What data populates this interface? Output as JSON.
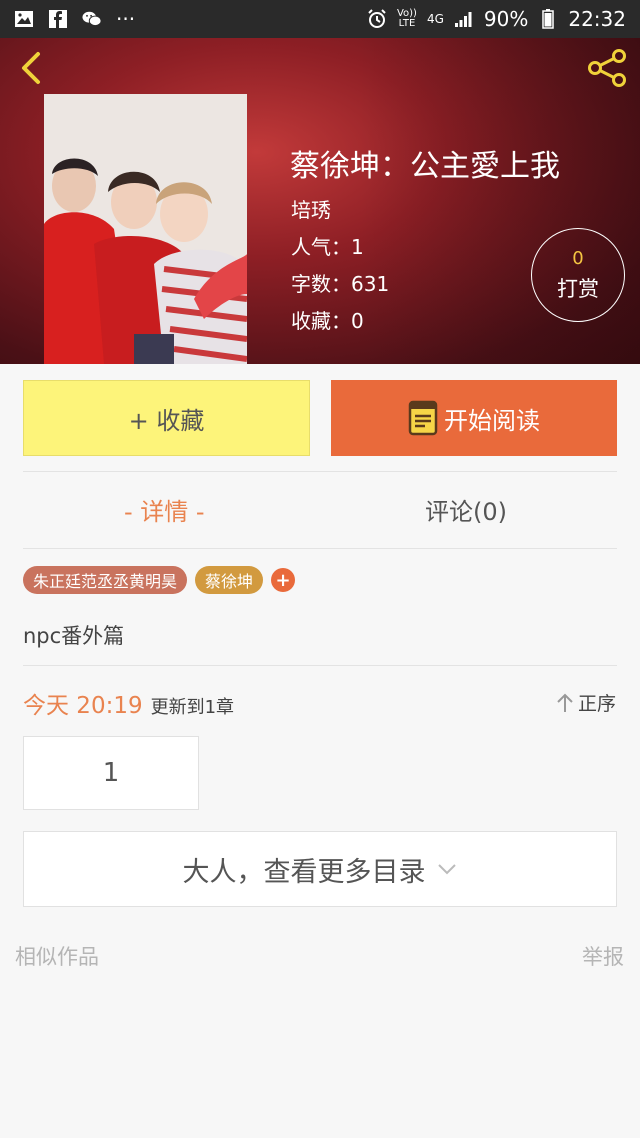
{
  "statusbar": {
    "network_lte_top": "Vo))",
    "network_lte_bottom": "LTE",
    "network_4g": "4G",
    "battery": "90%",
    "time": "22:32",
    "more_dots": "···"
  },
  "book": {
    "title": "蔡徐坤：公主愛上我",
    "author": "培琇",
    "popularity": "人气：1",
    "word_count": "字数：631",
    "favorites": "收藏：0"
  },
  "reward": {
    "count": "0",
    "label": "打赏"
  },
  "actions": {
    "favorite_label": "+ 收藏",
    "read_label": "开始阅读"
  },
  "tabs": {
    "detail": "- 详情 -",
    "comments": "评论(0)"
  },
  "tags": [
    "朱正廷范丞丞黄明昊",
    "蔡徐坤"
  ],
  "tag_add": "+",
  "description": "npc番外篇",
  "update": {
    "time": "今天 20:19",
    "text": "更新到1章",
    "order_label": "正序"
  },
  "chapters": [
    "1"
  ],
  "more_catalog": "大人，查看更多目录",
  "footer": {
    "similar": "相似作品",
    "report": "举报"
  },
  "colors": {
    "accent": "#e96a3b",
    "accent_text": "#e9834f",
    "favorite_bg": "#fdf47a",
    "hero": "#8e1f25"
  }
}
